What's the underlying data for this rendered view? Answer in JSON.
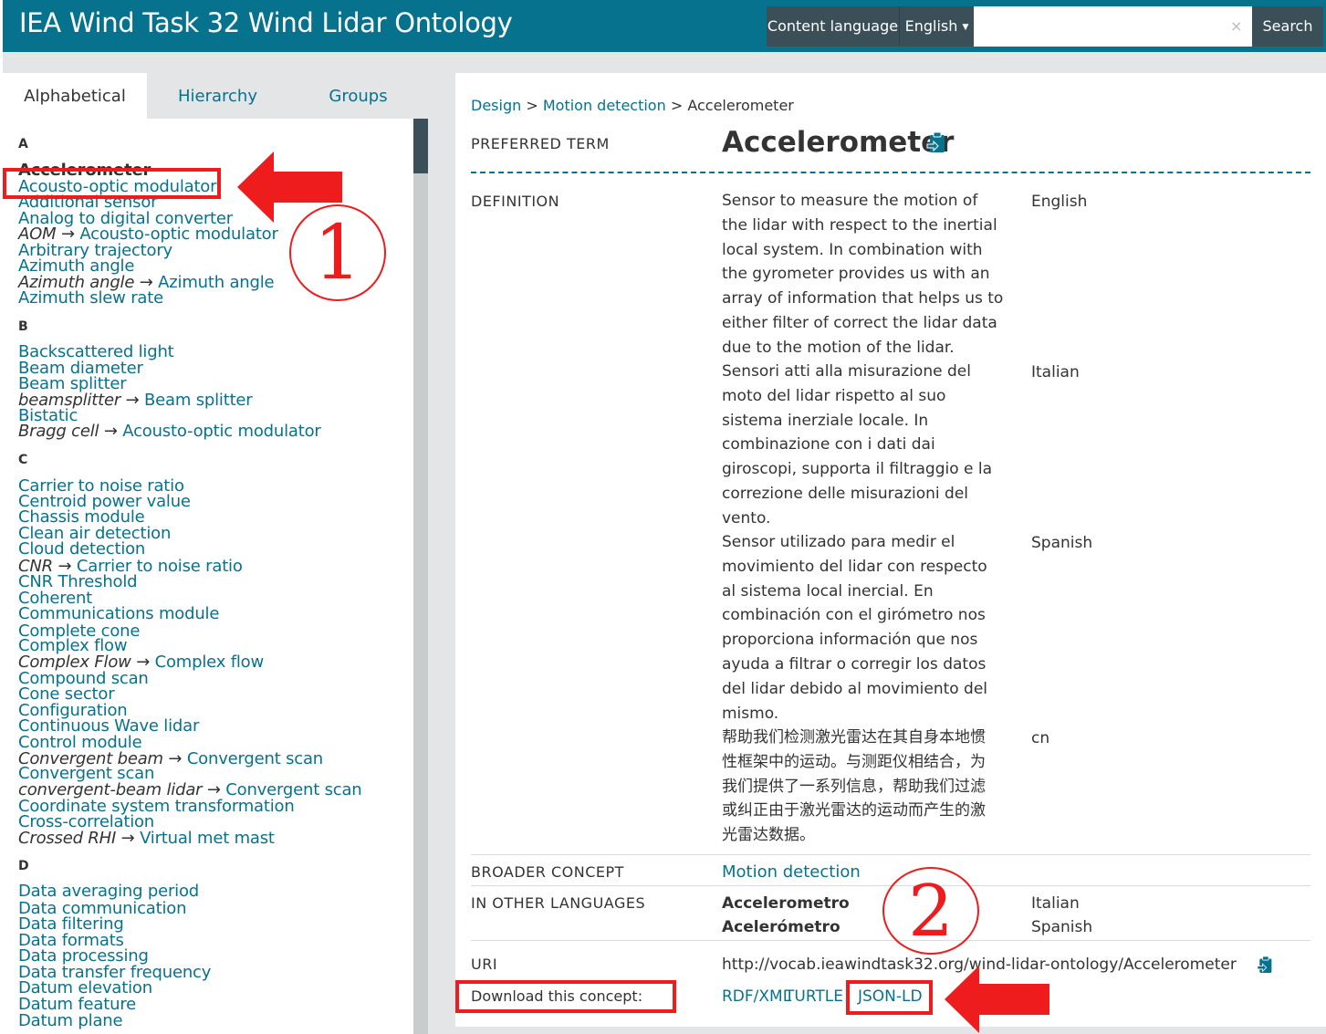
{
  "header": {
    "title": "IEA Wind Task 32 Wind Lidar Ontology",
    "content_language_label": "Content language",
    "language_selected": "English",
    "search_placeholder": "",
    "search_clear": "×",
    "search_button": "Search"
  },
  "sidebar": {
    "tabs": [
      "Alphabetical",
      "Hierarchy",
      "Groups"
    ],
    "groups": {
      "A": "A",
      "B": "B",
      "C": "C",
      "D": "D"
    },
    "items": [
      {
        "label": "Accelerometer"
      },
      {
        "label": "Acousto-optic modulator"
      },
      {
        "label": "Additional sensor"
      },
      {
        "label": "Analog to digital converter"
      },
      {
        "alt": "AOM",
        "label": "Acousto-optic modulator"
      },
      {
        "label": "Arbitrary trajectory"
      },
      {
        "label": "Azimuth angle"
      },
      {
        "alt": "Azimuth angle",
        "label": "Azimuth angle"
      },
      {
        "label": "Azimuth slew rate"
      },
      {
        "label": "Backscattered light"
      },
      {
        "label": "Beam diameter"
      },
      {
        "label": "Beam splitter"
      },
      {
        "alt": "beamsplitter",
        "label": "Beam splitter"
      },
      {
        "label": "Bistatic"
      },
      {
        "alt": "Bragg cell",
        "label": "Acousto-optic modulator"
      },
      {
        "label": "Carrier to noise ratio"
      },
      {
        "label": "Centroid power value"
      },
      {
        "label": "Chassis module"
      },
      {
        "label": "Clean air detection"
      },
      {
        "label": "Cloud detection"
      },
      {
        "alt": "CNR",
        "label": "Carrier to noise ratio"
      },
      {
        "label": "CNR Threshold"
      },
      {
        "label": "Coherent"
      },
      {
        "label": "Communications module"
      },
      {
        "label": "Complete cone"
      },
      {
        "label": "Complex flow"
      },
      {
        "alt": "Complex Flow",
        "label": "Complex flow"
      },
      {
        "label": "Compound scan"
      },
      {
        "label": "Cone sector"
      },
      {
        "label": "Configuration"
      },
      {
        "label": "Continuous Wave lidar"
      },
      {
        "label": "Control module"
      },
      {
        "alt": "Convergent beam",
        "label": "Convergent scan"
      },
      {
        "label": "Convergent scan"
      },
      {
        "alt": "convergent-beam lidar",
        "label": "Convergent scan"
      },
      {
        "label": "Coordinate system transformation"
      },
      {
        "label": "Cross-correlation"
      },
      {
        "alt": "Crossed RHI",
        "label": "Virtual met mast"
      },
      {
        "label": "Data averaging period"
      },
      {
        "label": "Data communication"
      },
      {
        "label": "Data filtering"
      },
      {
        "label": "Data formats"
      },
      {
        "label": "Data processing"
      },
      {
        "label": "Data transfer frequency"
      },
      {
        "label": "Datum elevation"
      },
      {
        "label": "Datum feature"
      },
      {
        "label": "Datum plane"
      }
    ]
  },
  "concept": {
    "breadcrumb": [
      "Design",
      "Motion detection",
      "Accelerometer"
    ],
    "breadcrumb_sep": ">",
    "labels": {
      "preferred_term": "PREFERRED TERM",
      "definition": "DEFINITION",
      "broader": "BROADER CONCEPT",
      "other_langs": "IN OTHER LANGUAGES",
      "uri": "URI",
      "download": "Download this concept:"
    },
    "preferred_term": "Accelerometer",
    "definitions": [
      {
        "text": "Sensor to measure the motion of the lidar with respect to the inertial local system. In combination with the gyrometer provides us with an array of information that helps us to either filter of correct the lidar data due to the motion of the lidar.",
        "lang": "English"
      },
      {
        "text": "Sensori atti alla misurazione del moto del lidar rispetto al suo sistema inerziale locale. In combinazione con i dati dai giroscopi, supporta il filtraggio e la correzione delle misurazioni del vento.",
        "lang": "Italian"
      },
      {
        "text": "Sensor utilizado para medir el movimiento del lidar con respecto al sistema local inercial. En combinación con el girómetro nos proporciona información que nos ayuda a filtrar o corregir los datos del lidar debido al movimiento del mismo.",
        "lang": "Spanish"
      },
      {
        "text": "帮助我们检测激光雷达在其自身本地惯性框架中的运动。与测距仪相结合，为我们提供了一系列信息，帮助我们过滤或纠正由于激光雷达的运动而产生的激光雷达数据。",
        "lang": "cn"
      }
    ],
    "broader": "Motion detection",
    "other_languages": [
      {
        "term": "Accelerometro",
        "lang": "Italian"
      },
      {
        "term": "Acelerómetro",
        "lang": "Spanish"
      }
    ],
    "uri": "http://vocab.ieawindtask32.org/wind-lidar-ontology/Accelerometer",
    "downloads": [
      "RDF/XML",
      "TURTLE",
      "JSON-LD"
    ]
  },
  "annotations": {
    "step1": "1",
    "step2": "2",
    "color": "#ee1c1c"
  },
  "colors": {
    "header_bg": "#06728d",
    "link": "#06728d",
    "dark_control": "#3b4f58",
    "panel_bg": "#e3e5e6"
  }
}
